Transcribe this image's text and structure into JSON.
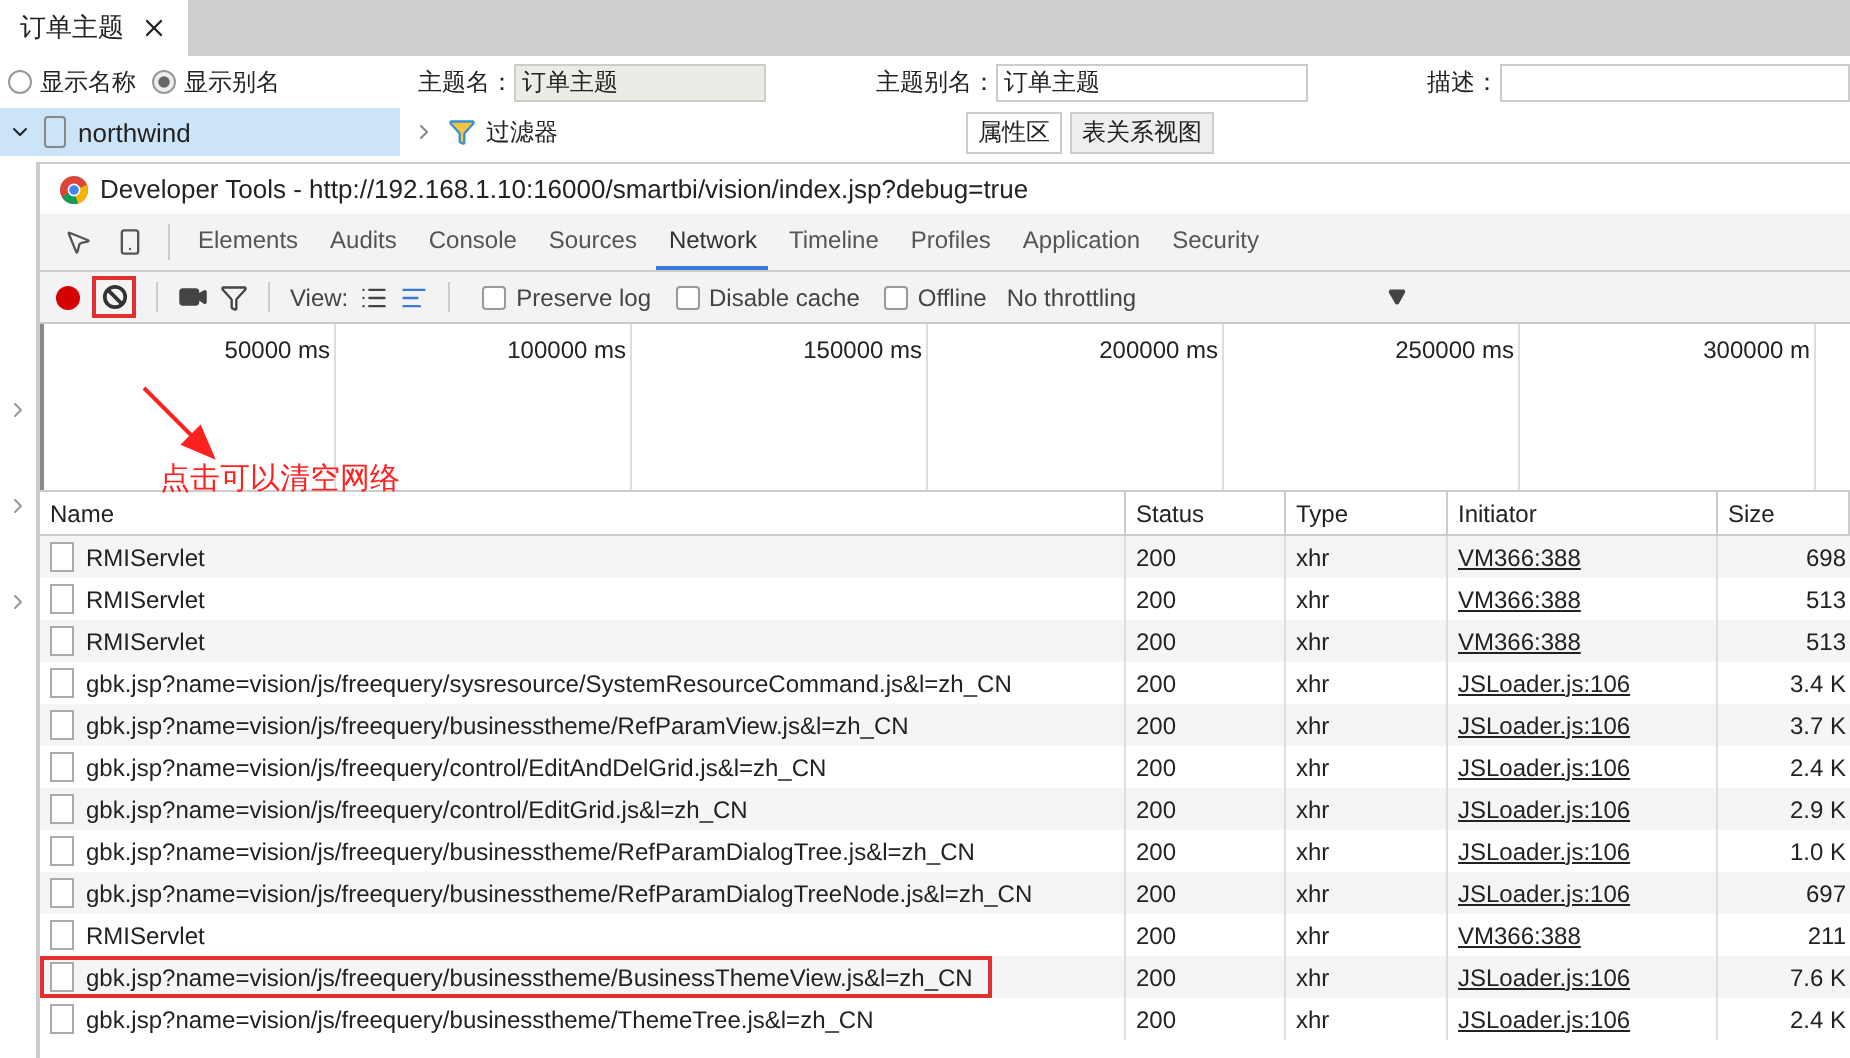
{
  "page_tabs": [
    {
      "label": "订单主题",
      "selected": true
    }
  ],
  "display_options": [
    {
      "label": "显示名称",
      "selected": false
    },
    {
      "label": "显示别名",
      "selected": true
    }
  ],
  "fields": [
    {
      "label": "主题名：",
      "value": "订单主题",
      "disabled": true
    },
    {
      "label": "主题别名：",
      "value": "订单主题",
      "disabled": false
    },
    {
      "label": "描述：",
      "disabled": false
    }
  ],
  "tree": {
    "label": "northwind",
    "expanded": true,
    "selected": true
  },
  "filter": {
    "label": "过滤器",
    "expanded": false
  },
  "panel_tabs": [
    {
      "label": "属性区",
      "selected": true
    },
    {
      "label": "表关系视图",
      "selected": false
    }
  ],
  "devtools": {
    "title": "Developer Tools - http://192.168.1.10:16000/smartbi/vision/index.jsp?debug=true",
    "tabs": [
      {
        "label": "Elements",
        "selected": false
      },
      {
        "label": "Audits",
        "selected": false
      },
      {
        "label": "Console",
        "selected": false
      },
      {
        "label": "Sources",
        "selected": false
      },
      {
        "label": "Network",
        "selected": true
      },
      {
        "label": "Timeline",
        "selected": false
      },
      {
        "label": "Profiles",
        "selected": false
      },
      {
        "label": "Application",
        "selected": false
      },
      {
        "label": "Security",
        "selected": false
      }
    ],
    "recording": true,
    "view_label": "View:",
    "options": [
      {
        "label": "Preserve log",
        "checked": false
      },
      {
        "label": "Disable cache",
        "checked": false
      },
      {
        "label": "Offline",
        "checked": false
      }
    ],
    "throttling": "No throttling",
    "annotation": "点击可以清空网络",
    "ticks": [
      "50000 ms",
      "100000 ms",
      "150000 ms",
      "200000 ms",
      "250000 ms",
      "300000 m"
    ],
    "columns": [
      "Name",
      "Status",
      "Type",
      "Initiator",
      "Size"
    ],
    "rows": [
      {
        "name": "RMIServlet",
        "status": "200",
        "type": "xhr",
        "initiator": "VM366:388",
        "size": "698",
        "highlighted": false
      },
      {
        "name": "RMIServlet",
        "status": "200",
        "type": "xhr",
        "initiator": "VM366:388",
        "size": "513",
        "highlighted": false
      },
      {
        "name": "RMIServlet",
        "status": "200",
        "type": "xhr",
        "initiator": "VM366:388",
        "size": "513",
        "highlighted": false
      },
      {
        "name": "gbk.jsp?name=vision/js/freequery/sysresource/SystemResourceCommand.js&l=zh_CN",
        "status": "200",
        "type": "xhr",
        "initiator": "JSLoader.js:106",
        "size": "3.4 K",
        "highlighted": false
      },
      {
        "name": "gbk.jsp?name=vision/js/freequery/businesstheme/RefParamView.js&l=zh_CN",
        "status": "200",
        "type": "xhr",
        "initiator": "JSLoader.js:106",
        "size": "3.7 K",
        "highlighted": false
      },
      {
        "name": "gbk.jsp?name=vision/js/freequery/control/EditAndDelGrid.js&l=zh_CN",
        "status": "200",
        "type": "xhr",
        "initiator": "JSLoader.js:106",
        "size": "2.4 K",
        "highlighted": false
      },
      {
        "name": "gbk.jsp?name=vision/js/freequery/control/EditGrid.js&l=zh_CN",
        "status": "200",
        "type": "xhr",
        "initiator": "JSLoader.js:106",
        "size": "2.9 K",
        "highlighted": false
      },
      {
        "name": "gbk.jsp?name=vision/js/freequery/businesstheme/RefParamDialogTree.js&l=zh_CN",
        "status": "200",
        "type": "xhr",
        "initiator": "JSLoader.js:106",
        "size": "1.0 K",
        "highlighted": false
      },
      {
        "name": "gbk.jsp?name=vision/js/freequery/businesstheme/RefParamDialogTreeNode.js&l=zh_CN",
        "status": "200",
        "type": "xhr",
        "initiator": "JSLoader.js:106",
        "size": "697",
        "highlighted": false
      },
      {
        "name": "RMIServlet",
        "status": "200",
        "type": "xhr",
        "initiator": "VM366:388",
        "size": "211",
        "highlighted": false
      },
      {
        "name": "gbk.jsp?name=vision/js/freequery/businesstheme/BusinessThemeView.js&l=zh_CN",
        "status": "200",
        "type": "xhr",
        "initiator": "JSLoader.js:106",
        "size": "7.6 K",
        "highlighted": true
      },
      {
        "name": "gbk.jsp?name=vision/js/freequery/businesstheme/ThemeTree.js&l=zh_CN",
        "status": "200",
        "type": "xhr",
        "initiator": "JSLoader.js:106",
        "size": "2.4 K",
        "highlighted": false
      }
    ]
  }
}
